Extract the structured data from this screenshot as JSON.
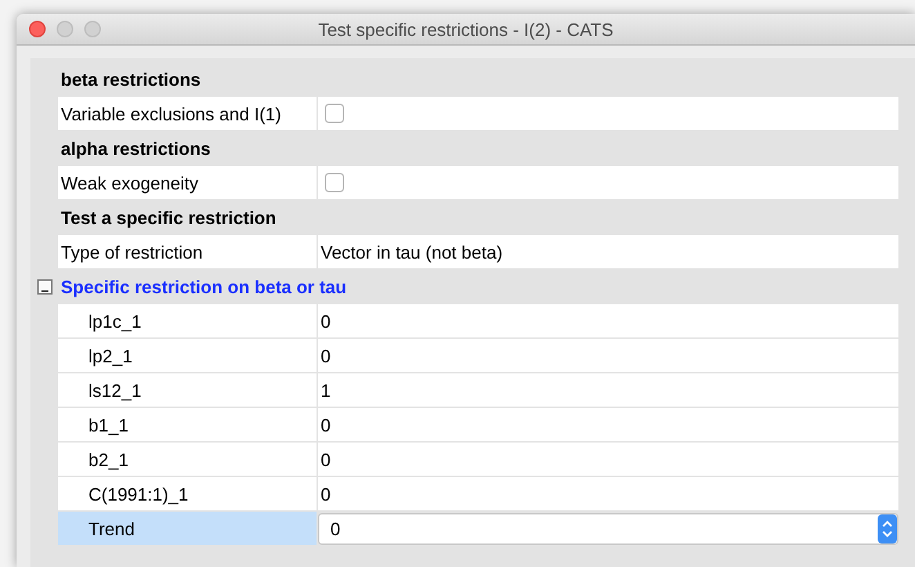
{
  "window": {
    "title": "Test specific restrictions - I(2) - CATS"
  },
  "rows": [
    {
      "kind": "header",
      "label": "beta restrictions"
    },
    {
      "kind": "checkbox",
      "label": "Variable exclusions and I(1)",
      "checked": false
    },
    {
      "kind": "header",
      "label": "alpha restrictions"
    },
    {
      "kind": "checkbox",
      "label": "Weak exogeneity",
      "checked": false
    },
    {
      "kind": "header",
      "label": "Test a specific restriction"
    },
    {
      "kind": "text",
      "label": "Type of restriction",
      "value": "Vector in tau (not beta)"
    },
    {
      "kind": "group",
      "label": "Specific restriction on beta or tau",
      "expanded": true,
      "children": [
        {
          "kind": "value",
          "label": "lp1c_1",
          "value": "0",
          "selected": false
        },
        {
          "kind": "value",
          "label": "lp2_1",
          "value": "0",
          "selected": false
        },
        {
          "kind": "value",
          "label": "ls12_1",
          "value": "1",
          "selected": false
        },
        {
          "kind": "value",
          "label": "b1_1",
          "value": "0",
          "selected": false
        },
        {
          "kind": "value",
          "label": "b2_1",
          "value": "0",
          "selected": false
        },
        {
          "kind": "value",
          "label": "C(1991:1)_1",
          "value": "0",
          "selected": false
        },
        {
          "kind": "spin",
          "label": "Trend",
          "value": "0",
          "selected": true
        }
      ]
    }
  ]
}
